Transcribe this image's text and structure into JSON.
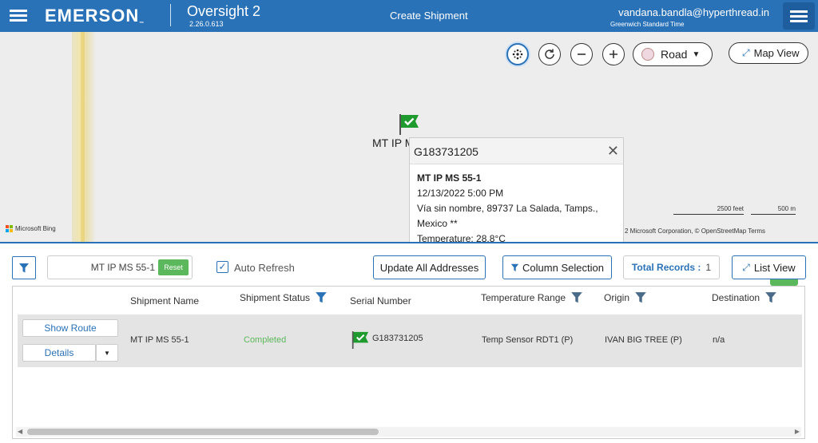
{
  "header": {
    "brand": "EMERSON",
    "brand_tm": "™",
    "app_name": "Oversight 2",
    "version": "2.26.0.613",
    "page_title": "Create Shipment",
    "user_email": "vandana.bandla@hyperthread.in",
    "timezone": "Greenwich Standard Time"
  },
  "map": {
    "style_label": "Road",
    "map_view_label": "Map View",
    "pin_label": "MT IP M",
    "bing_label": "Microsoft Bing",
    "scale_feet": "2500 feet",
    "scale_m": "500 m",
    "copyright": "2 Microsoft Corporation, © OpenStreetMap  Terms",
    "popup": {
      "serial": "G183731205",
      "name": "MT IP MS 55-1",
      "datetime": "12/13/2022 5:00 PM",
      "address": "Vía sin nombre, 89737 La Salada, Tamps., Mexico **",
      "temperature": "Temperature: 28.8°C"
    }
  },
  "toolbar": {
    "search_value": "MT IP MS 55-1",
    "reset_label": "Reset",
    "auto_refresh_label": "Auto Refresh",
    "auto_refresh_checked": true,
    "update_all_label": "Update All Addresses",
    "column_selection_label": "Column Selection",
    "total_records_label": "Total Records :",
    "total_records_value": "1",
    "list_view_label": "List View"
  },
  "table": {
    "columns": [
      "Shipment Name",
      "Shipment Status",
      "Serial Number",
      "Temperature Range",
      "Origin",
      "Destination"
    ],
    "rows": [
      {
        "show_route": "Show Route",
        "details": "Details",
        "shipment_name": "MT IP MS 55-1",
        "status": "Completed",
        "serial": "G183731205",
        "temp_range": "Temp Sensor RDT1 (P)",
        "origin": "IVAN BIG TREE (P)",
        "destination": "n/a"
      }
    ]
  },
  "colors": {
    "header_bg": "#2a72b8",
    "accent": "#2a72b8",
    "status_completed": "#5cb85c",
    "flag_green": "#1e9a2e"
  }
}
